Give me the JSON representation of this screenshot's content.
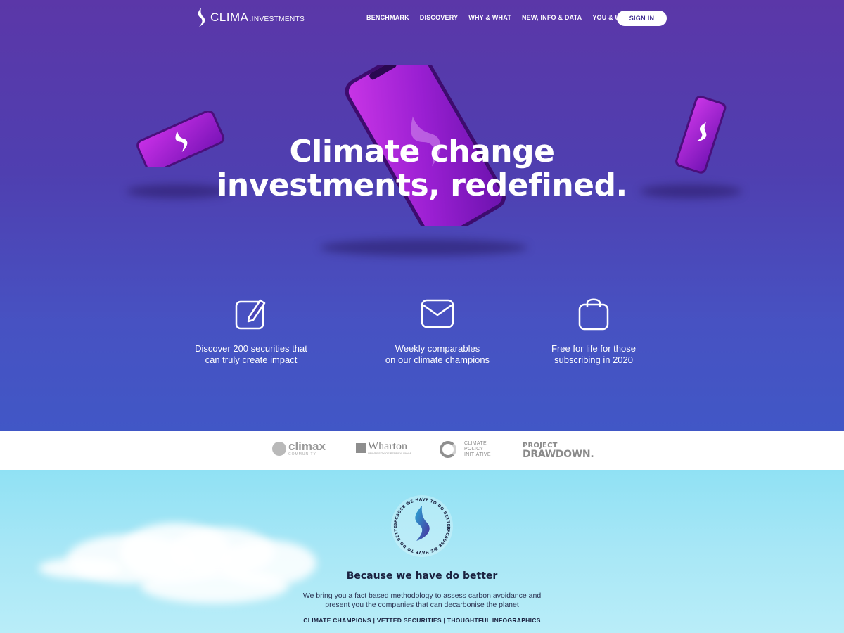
{
  "header": {
    "brand": "CLIMA",
    "brand_suffix": ".INVESTMENTS",
    "menu": [
      "BENCHMARK",
      "DISCOVERY",
      "WHY & WHAT",
      "NEW, INFO & DATA",
      "YOU & US"
    ],
    "sign_in_label": "SIGN IN"
  },
  "hero": {
    "headline_line1": "Climate change",
    "headline_line2": "investments, redefined."
  },
  "features": [
    {
      "icon": "pencil-square-icon",
      "line1": "Discover 200 securities that",
      "line2": "can truly create impact"
    },
    {
      "icon": "envelope-icon",
      "line1": "Weekly comparables",
      "line2": "on our climate champions"
    },
    {
      "icon": "bag-icon",
      "line1": "Free for life for those",
      "line2": "subscribing in 2020"
    }
  ],
  "partners": {
    "climax": {
      "name": "climax",
      "sub": "COMMUNITY"
    },
    "wharton": {
      "name": "Wharton",
      "sub": "UNIVERSITY OF PENNSYLVANIA"
    },
    "cpi": {
      "line1": "CLIMATE",
      "line2": "POLICY",
      "line3": "INITIATIVE"
    },
    "drawdown": {
      "line1": "PROJECT",
      "line2": "DRAWDOWN."
    }
  },
  "mission": {
    "badge_text": "BECAUSE WE HAVE TO DO BETTER",
    "title": "Because we have do better",
    "desc_line1": "We bring you a fact based methodology to assess carbon avoidance and",
    "desc_line2": "present you the companies that can decarbonise the planet",
    "tags": "CLIMATE CHAMPIONS | VETTED SECURITIES | THOUGHTFUL INFOGRAPHICS"
  },
  "colors": {
    "hero_top": "#5b37a8",
    "hero_bottom": "#4157c6",
    "phone_purple": "#a21fd8",
    "sky": "#90e1f4",
    "text_dark": "#1b2240"
  }
}
